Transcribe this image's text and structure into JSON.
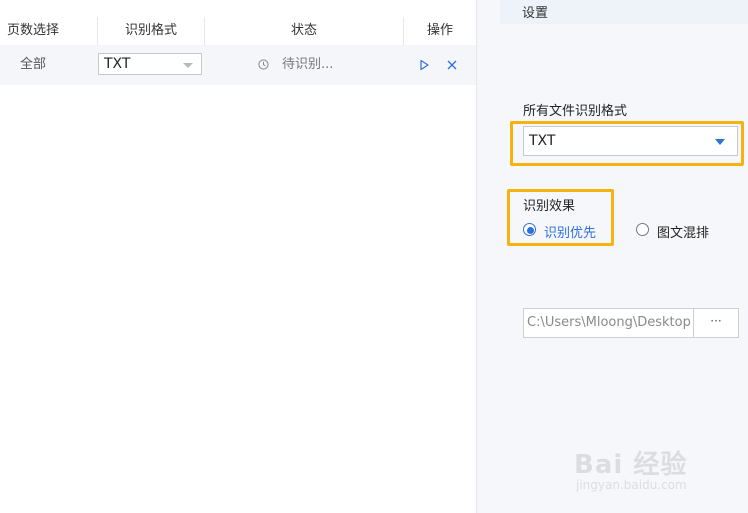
{
  "table": {
    "headers": [
      "页数选择",
      "识别格式",
      "状态",
      "操作"
    ],
    "rows": [
      {
        "pages": "全部",
        "format": "TXT",
        "status": "待识别..."
      }
    ]
  },
  "settings": {
    "title": "设置",
    "all_format_label": "所有文件识别格式",
    "all_format_value": "TXT",
    "effect_label": "识别效果",
    "effect_options": [
      {
        "label": "识别优先",
        "selected": true
      },
      {
        "label": "图文混排",
        "selected": false
      }
    ],
    "output_path": "C:\\Users\\Mloong\\Desktop",
    "browse_label": "···"
  },
  "watermark": {
    "text": "Bai 经验",
    "domain": "jingyan.baidu.com"
  },
  "colors": {
    "accent_blue": "#2f6fe0",
    "highlight_orange": "#f6b20e",
    "row_bg": "#f4f6fa",
    "panel_bg": "#f5f7fa"
  },
  "icons": {
    "status_icon": "clock-icon",
    "start_icon": "play-icon",
    "remove_icon": "close-icon",
    "dropdown_icon": "caret-down-icon"
  }
}
